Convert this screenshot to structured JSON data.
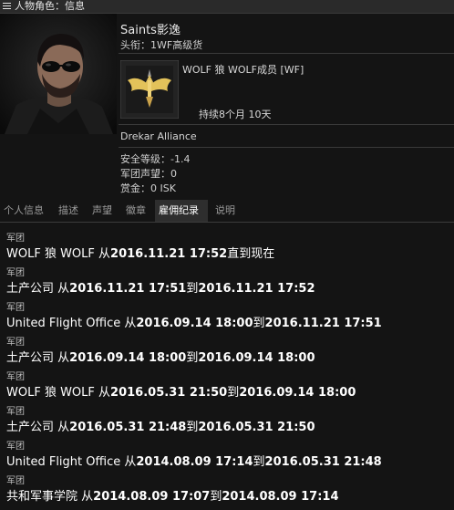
{
  "window": {
    "title": "人物角色：信息"
  },
  "pilot": {
    "name": "Saints影逸",
    "title": "头衔：1WF高级货"
  },
  "corporation": {
    "name": "WOLF 狼 WOLF成员 [WF]",
    "duration": "持续8个月 10天"
  },
  "alliance": "Drekar Alliance",
  "stats": [
    "安全等级：-1.4",
    "军团声望：0",
    "赏金：0 ISK"
  ],
  "tabs": [
    {
      "label": "个人信息",
      "active": false
    },
    {
      "label": "描述",
      "active": false
    },
    {
      "label": "声望",
      "active": false
    },
    {
      "label": "徽章",
      "active": false
    },
    {
      "label": "雇佣纪录",
      "active": true
    },
    {
      "label": "说明",
      "active": false
    }
  ],
  "history": [
    {
      "kind": "军团",
      "corp": "WOLF 狼 WOLF",
      "from_word": "从",
      "start": "2016.11.21 17:52",
      "to_word": "直到现在",
      "end": ""
    },
    {
      "kind": "军团",
      "corp": "土产公司",
      "from_word": "从",
      "start": "2016.11.21 17:51",
      "to_word": "到",
      "end": "2016.11.21 17:52"
    },
    {
      "kind": "军团",
      "corp": "United Flight Office",
      "from_word": "从",
      "start": "2016.09.14 18:00",
      "to_word": "到",
      "end": "2016.11.21 17:51"
    },
    {
      "kind": "军团",
      "corp": "土产公司",
      "from_word": "从",
      "start": "2016.09.14 18:00",
      "to_word": "到",
      "end": "2016.09.14 18:00"
    },
    {
      "kind": "军团",
      "corp": "WOLF 狼 WOLF",
      "from_word": "从",
      "start": "2016.05.31 21:50",
      "to_word": "到",
      "end": "2016.09.14 18:00"
    },
    {
      "kind": "军团",
      "corp": "土产公司",
      "from_word": "从",
      "start": "2016.05.31 21:48",
      "to_word": "到",
      "end": "2016.05.31 21:50"
    },
    {
      "kind": "军团",
      "corp": "United Flight Office",
      "from_word": "从",
      "start": "2014.08.09 17:14",
      "to_word": "到",
      "end": "2016.05.31 21:48"
    },
    {
      "kind": "军团",
      "corp": "共和军事学院",
      "from_word": "从",
      "start": "2014.08.09 17:07",
      "to_word": "到",
      "end": "2014.08.09 17:14"
    }
  ]
}
